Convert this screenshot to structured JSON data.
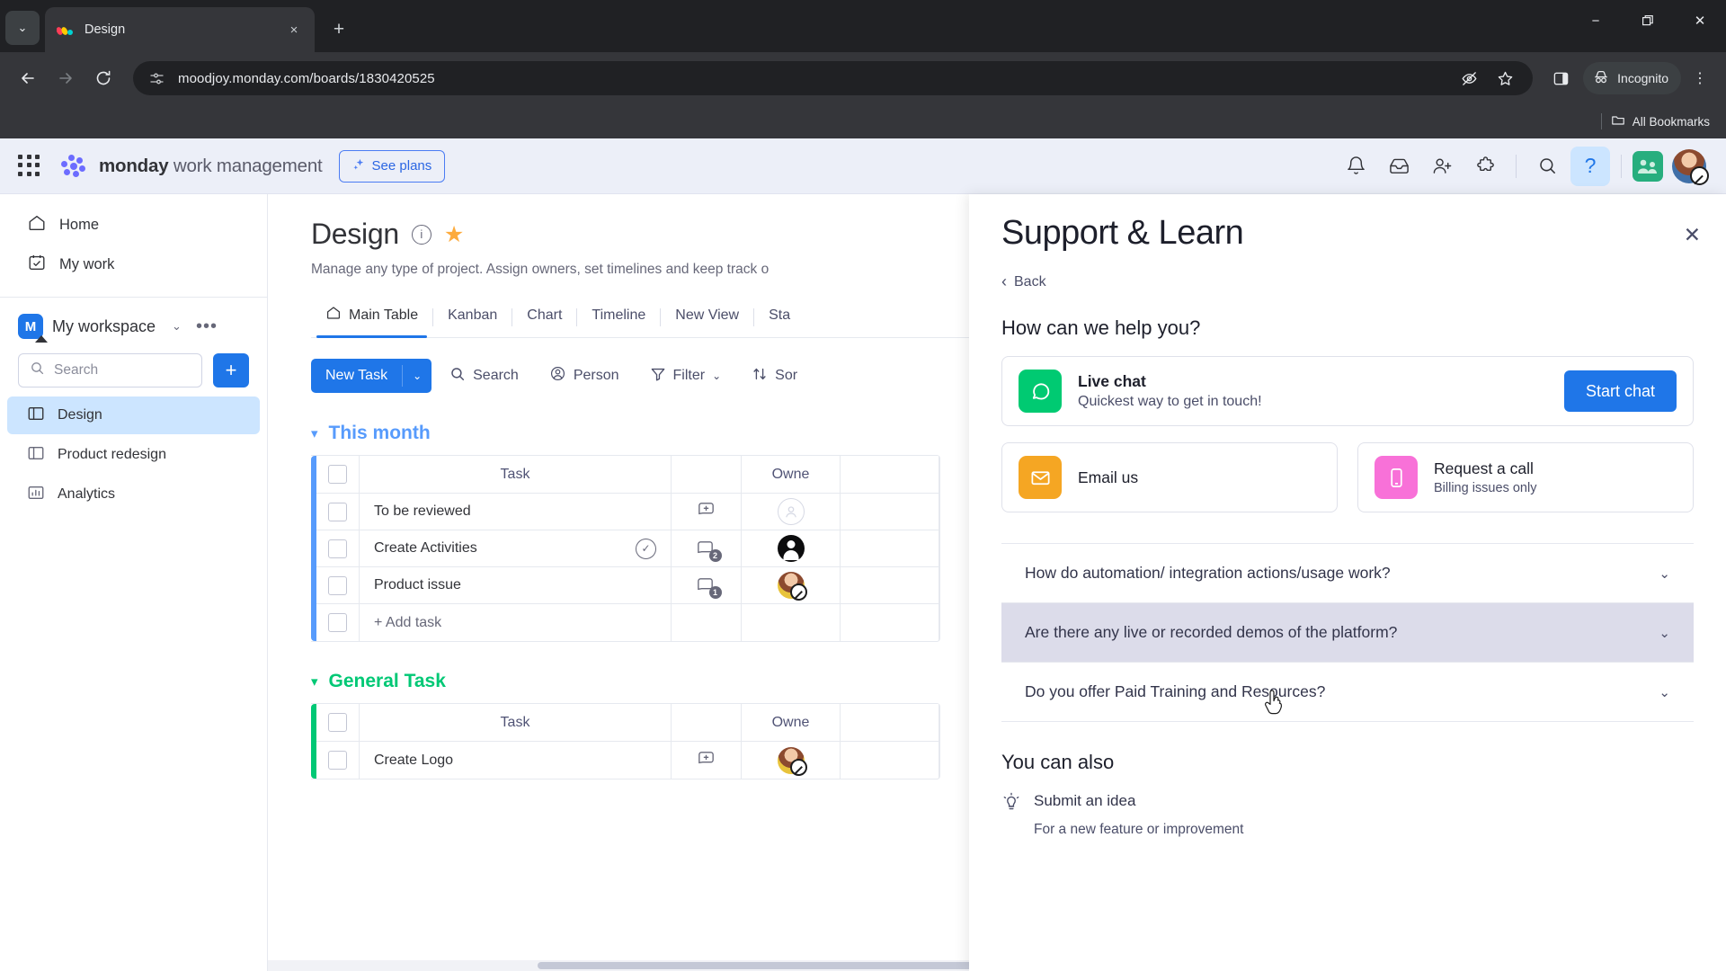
{
  "browser": {
    "tab": {
      "title": "Design",
      "favicon": "monday-logo-icon",
      "close": "×"
    },
    "new_tab": "+",
    "tab_list": "⌄",
    "window": {
      "minimize": "−",
      "maximize": "❐",
      "close": "✕"
    },
    "nav": {
      "back": "←",
      "forward": "→",
      "reload": "↻"
    },
    "omnibox": {
      "url": "moodjoy.monday.com/boards/1830420525",
      "site_icon": "site-settings-icon"
    },
    "actions": {
      "tracking": "eye-off-icon",
      "bookmark": "star-icon",
      "side_panel": "side-panel-icon",
      "menu": "⋮"
    },
    "incognito_label": "Incognito",
    "bookmarks_bar": {
      "all_bookmarks": "All Bookmarks"
    }
  },
  "topbar": {
    "brand_bold": "monday",
    "brand_light": " work management",
    "see_plans": "See plans",
    "icons": [
      "notifications-bell-icon",
      "inbox-icon",
      "invite-member-icon",
      "apps-puzzle-icon",
      "search-icon",
      "help-question-icon"
    ],
    "help_label": "?"
  },
  "sidebar": {
    "nav": [
      {
        "label": "Home",
        "icon": "home-icon"
      },
      {
        "label": "My work",
        "icon": "my-work-calendar-icon"
      }
    ],
    "workspace": {
      "initial": "M",
      "name": "My workspace",
      "caret": "⌄",
      "dots": "•••"
    },
    "search_placeholder": "Search",
    "add_button": "+",
    "boards": [
      {
        "label": "Design",
        "icon": "board-icon",
        "selected": true
      },
      {
        "label": "Product redesign",
        "icon": "board-icon",
        "selected": false
      },
      {
        "label": "Analytics",
        "icon": "dashboard-chart-icon",
        "selected": false
      }
    ]
  },
  "board": {
    "title": "Design",
    "description": "Manage any type of project. Assign owners, set timelines and keep track o",
    "views": [
      "Main Table",
      "Kanban",
      "Chart",
      "Timeline",
      "New View",
      "Sta"
    ],
    "active_view": "Main Table",
    "toolbar": {
      "new_task": "New Task",
      "new_task_caret": "⌄",
      "search": "Search",
      "person": "Person",
      "filter": "Filter",
      "filter_caret": "⌄",
      "sort": "Sor"
    },
    "groups": [
      {
        "name": "This month",
        "color": "#579bfc",
        "columns": [
          "Task",
          "Owne"
        ],
        "rows": [
          {
            "task": "To be reviewed",
            "done": false,
            "chat": "",
            "owner": "empty-avatar"
          },
          {
            "task": "Create Activities",
            "done": true,
            "chat": "2",
            "owner": "dark-avatar"
          },
          {
            "task": "Product issue",
            "done": false,
            "chat": "1",
            "owner": "photo-avatar"
          }
        ],
        "add_row": "+ Add task"
      },
      {
        "name": "General Task",
        "color": "#00c875",
        "columns": [
          "Task",
          "Owne"
        ],
        "rows": [
          {
            "task": "Create Logo",
            "done": false,
            "chat": "",
            "owner": "photo-avatar"
          }
        ],
        "add_row": ""
      }
    ]
  },
  "panel": {
    "title": "Support & Learn",
    "close": "✕",
    "back": "Back",
    "back_caret": "‹",
    "heading": "How can we help you?",
    "live_chat": {
      "title": "Live chat",
      "subtitle": "Quickest way to get in touch!",
      "button": "Start chat",
      "icon": "chat-bubble-icon"
    },
    "options": [
      {
        "title": "Email us",
        "subtitle": "",
        "icon": "envelope-icon"
      },
      {
        "title": "Request a call",
        "subtitle": "Billing issues only",
        "icon": "phone-icon"
      }
    ],
    "faqs": [
      {
        "text": "How do automation/ integration actions/usage work?",
        "highlighted": false,
        "caret": "⌄"
      },
      {
        "text": "Are there any live or recorded demos of the platform?",
        "highlighted": true,
        "caret": "⌄"
      },
      {
        "text": "Do you offer Paid Training and Resources?",
        "highlighted": false,
        "caret": "⌄"
      }
    ],
    "also_heading": "You can also",
    "also_items": [
      {
        "title": "Submit an idea",
        "subtitle": "For a new feature or improvement",
        "icon": "lightbulb-icon"
      }
    ]
  }
}
